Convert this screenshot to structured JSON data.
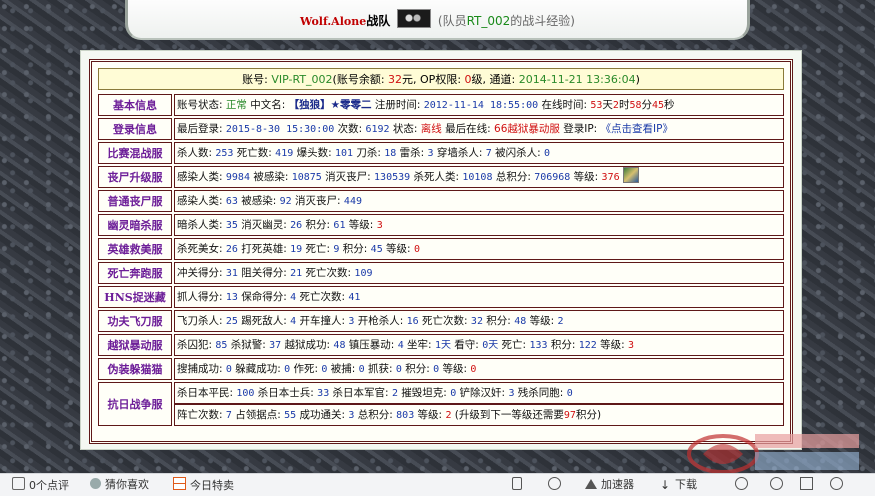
{
  "header": {
    "team_name": "Wolf.Alone",
    "team_suffix": "战队",
    "player_prefix": "(队员",
    "player_id": "RT_002",
    "player_suffix": "的战斗经验)"
  },
  "account": {
    "label_account": "账号: ",
    "account_id": "VIP-RT_002",
    "label_balance": "(账号余额: ",
    "balance": "32",
    "label_yuan_op": "元, OP权限: ",
    "op_level": "0",
    "label_level_channel": "级, 通道: ",
    "channel_time": "2014-11-21 13:36:04",
    "close_paren": ")"
  },
  "rows": [
    {
      "category": "基本信息",
      "fields": {
        "status_label": "账号状态: ",
        "status_value": "正常",
        "cn_label": " 中文名: ",
        "cn_value": "【独狼】★零零二",
        "reg_label": " 注册时间: ",
        "reg_value": "2012-11-14 18:55:00",
        "online_label": " 在线时间: ",
        "days": "53",
        "d_unit": "天",
        "hours": "2",
        "h_unit": "时",
        "minutes": "58",
        "m_unit": "分",
        "seconds": "45",
        "s_unit": "秒"
      }
    },
    {
      "category": "登录信息",
      "fields": {
        "last_label": "最后登录: ",
        "last_value": "2015-8-30 15:30:00",
        "times_label": " 次数: ",
        "times_value": "6192",
        "state_label": " 状态: ",
        "state_value": "离线",
        "last_online_label": " 最后在线: ",
        "last_online_value": "66越狱暴动服",
        "ip_label": " 登录IP: ",
        "ip_value": "《点击查看IP》"
      }
    },
    {
      "category": "比赛混战服",
      "text": [
        [
          "杀人数: ",
          ""
        ],
        [
          "253",
          "n"
        ],
        [
          " 死亡数: ",
          ""
        ],
        [
          "419",
          "n"
        ],
        [
          " 爆头数: ",
          ""
        ],
        [
          "101",
          "n"
        ],
        [
          " 刀杀: ",
          ""
        ],
        [
          "18",
          "n"
        ],
        [
          " 雷杀: ",
          ""
        ],
        [
          "3",
          "n"
        ],
        [
          " 穿墙杀人: ",
          ""
        ],
        [
          "7",
          "n"
        ],
        [
          " 被闪杀人: ",
          ""
        ],
        [
          "0",
          "n"
        ]
      ]
    },
    {
      "category": "丧尸升级服",
      "text": [
        [
          "感染人类: ",
          ""
        ],
        [
          "9984",
          "n"
        ],
        [
          " 被感染: ",
          ""
        ],
        [
          "10875",
          "n"
        ],
        [
          " 消灭丧尸: ",
          ""
        ],
        [
          "130539",
          "n"
        ],
        [
          " 杀死人类: ",
          ""
        ],
        [
          "10108",
          "n"
        ],
        [
          " 总积分: ",
          ""
        ],
        [
          "706968",
          "n"
        ],
        [
          " 等级: ",
          ""
        ],
        [
          "376",
          "r"
        ]
      ],
      "rank_icon": "rank-badge-icon"
    },
    {
      "category": "普通丧尸服",
      "text": [
        [
          "感染人类: ",
          ""
        ],
        [
          "63",
          "n"
        ],
        [
          " 被感染: ",
          ""
        ],
        [
          "92",
          "n"
        ],
        [
          " 消灭丧尸: ",
          ""
        ],
        [
          "449",
          "n"
        ]
      ]
    },
    {
      "category": "幽灵暗杀服",
      "text": [
        [
          "暗杀人类: ",
          ""
        ],
        [
          "35",
          "n"
        ],
        [
          " 消灭幽灵: ",
          ""
        ],
        [
          "26",
          "n"
        ],
        [
          " 积分: ",
          ""
        ],
        [
          "61",
          "n"
        ],
        [
          " 等级: ",
          ""
        ],
        [
          "3",
          "r"
        ]
      ]
    },
    {
      "category": "英雄救美服",
      "text": [
        [
          "杀死美女: ",
          ""
        ],
        [
          "26",
          "n"
        ],
        [
          " 打死英雄: ",
          ""
        ],
        [
          "19",
          "n"
        ],
        [
          " 死亡: ",
          ""
        ],
        [
          "9",
          "n"
        ],
        [
          " 积分: ",
          ""
        ],
        [
          "45",
          "n"
        ],
        [
          " 等级: ",
          ""
        ],
        [
          "0",
          "r"
        ]
      ]
    },
    {
      "category": "死亡奔跑服",
      "text": [
        [
          "冲关得分: ",
          ""
        ],
        [
          "31",
          "n"
        ],
        [
          " 阻关得分: ",
          ""
        ],
        [
          "21",
          "n"
        ],
        [
          " 死亡次数: ",
          ""
        ],
        [
          "109",
          "n"
        ]
      ]
    },
    {
      "category": "HNS捉迷藏",
      "text": [
        [
          "抓人得分: ",
          ""
        ],
        [
          "13",
          "n"
        ],
        [
          " 保命得分: ",
          ""
        ],
        [
          "4",
          "n"
        ],
        [
          " 死亡次数: ",
          ""
        ],
        [
          "41",
          "n"
        ]
      ]
    },
    {
      "category": "功夫飞刀服",
      "text": [
        [
          "飞刀杀人: ",
          ""
        ],
        [
          "25",
          "n"
        ],
        [
          " 踢死敌人: ",
          ""
        ],
        [
          "4",
          "n"
        ],
        [
          " 开车撞人: ",
          ""
        ],
        [
          "3",
          "n"
        ],
        [
          " 开枪杀人: ",
          ""
        ],
        [
          "16",
          "n"
        ],
        [
          " 死亡次数: ",
          ""
        ],
        [
          "32",
          "n"
        ],
        [
          " 积分: ",
          ""
        ],
        [
          "48",
          "n"
        ],
        [
          " 等级: ",
          ""
        ],
        [
          "2",
          "n"
        ]
      ]
    },
    {
      "category": "越狱暴动服",
      "text": [
        [
          "杀囚犯: ",
          ""
        ],
        [
          "85",
          "n"
        ],
        [
          " 杀狱警: ",
          ""
        ],
        [
          "37",
          "n"
        ],
        [
          " 越狱成功: ",
          ""
        ],
        [
          "48",
          "n"
        ],
        [
          " 镇压暴动: ",
          ""
        ],
        [
          "4",
          "n"
        ],
        [
          " 坐牢: ",
          ""
        ],
        [
          "1天",
          "n"
        ],
        [
          " 看守: ",
          ""
        ],
        [
          "0天",
          "n"
        ],
        [
          " 死亡: ",
          ""
        ],
        [
          "133",
          "n"
        ],
        [
          " 积分: ",
          ""
        ],
        [
          "122",
          "n"
        ],
        [
          " 等级: ",
          ""
        ],
        [
          "3",
          "r"
        ]
      ]
    },
    {
      "category": "伪装躲猫猫",
      "text": [
        [
          "搜捕成功: ",
          ""
        ],
        [
          "0",
          "n"
        ],
        [
          " 躲藏成功: ",
          ""
        ],
        [
          "0",
          "n"
        ],
        [
          " 作死: ",
          ""
        ],
        [
          "0",
          "n"
        ],
        [
          " 被捕: ",
          ""
        ],
        [
          "0",
          "n"
        ],
        [
          " 抓获: ",
          ""
        ],
        [
          "0",
          "n"
        ],
        [
          " 积分: ",
          ""
        ],
        [
          "0",
          "n"
        ],
        [
          " 等级: ",
          ""
        ],
        [
          "0",
          "r"
        ]
      ]
    },
    {
      "category": "抗日战争服",
      "text": [
        [
          "杀日本平民: ",
          ""
        ],
        [
          "100",
          "n"
        ],
        [
          " 杀日本士兵: ",
          ""
        ],
        [
          "33",
          "n"
        ],
        [
          " 杀日本军官: ",
          ""
        ],
        [
          "2",
          "n"
        ],
        [
          " 摧毁坦克: ",
          ""
        ],
        [
          "0",
          "n"
        ],
        [
          " 铲除汉奸: ",
          ""
        ],
        [
          "3",
          "n"
        ],
        [
          " 残杀同胞: ",
          ""
        ],
        [
          "0",
          "n"
        ]
      ],
      "text2": [
        [
          "阵亡次数: ",
          ""
        ],
        [
          "7",
          "n"
        ],
        [
          " 占领据点: ",
          ""
        ],
        [
          "55",
          "n"
        ],
        [
          " 成功通关: ",
          ""
        ],
        [
          "3",
          "n"
        ],
        [
          " 总积分: ",
          ""
        ],
        [
          "803",
          "n"
        ],
        [
          " 等级: ",
          ""
        ],
        [
          "2",
          "r"
        ],
        [
          " (升级到下一等级还需要",
          ""
        ],
        [
          "97",
          "r"
        ],
        [
          "积分)",
          ""
        ]
      ]
    }
  ],
  "statusbar": {
    "comments": "0个点评",
    "guess": "猜你喜欢",
    "today": "今日特卖",
    "accelerator": "加速器",
    "download": "下载"
  }
}
